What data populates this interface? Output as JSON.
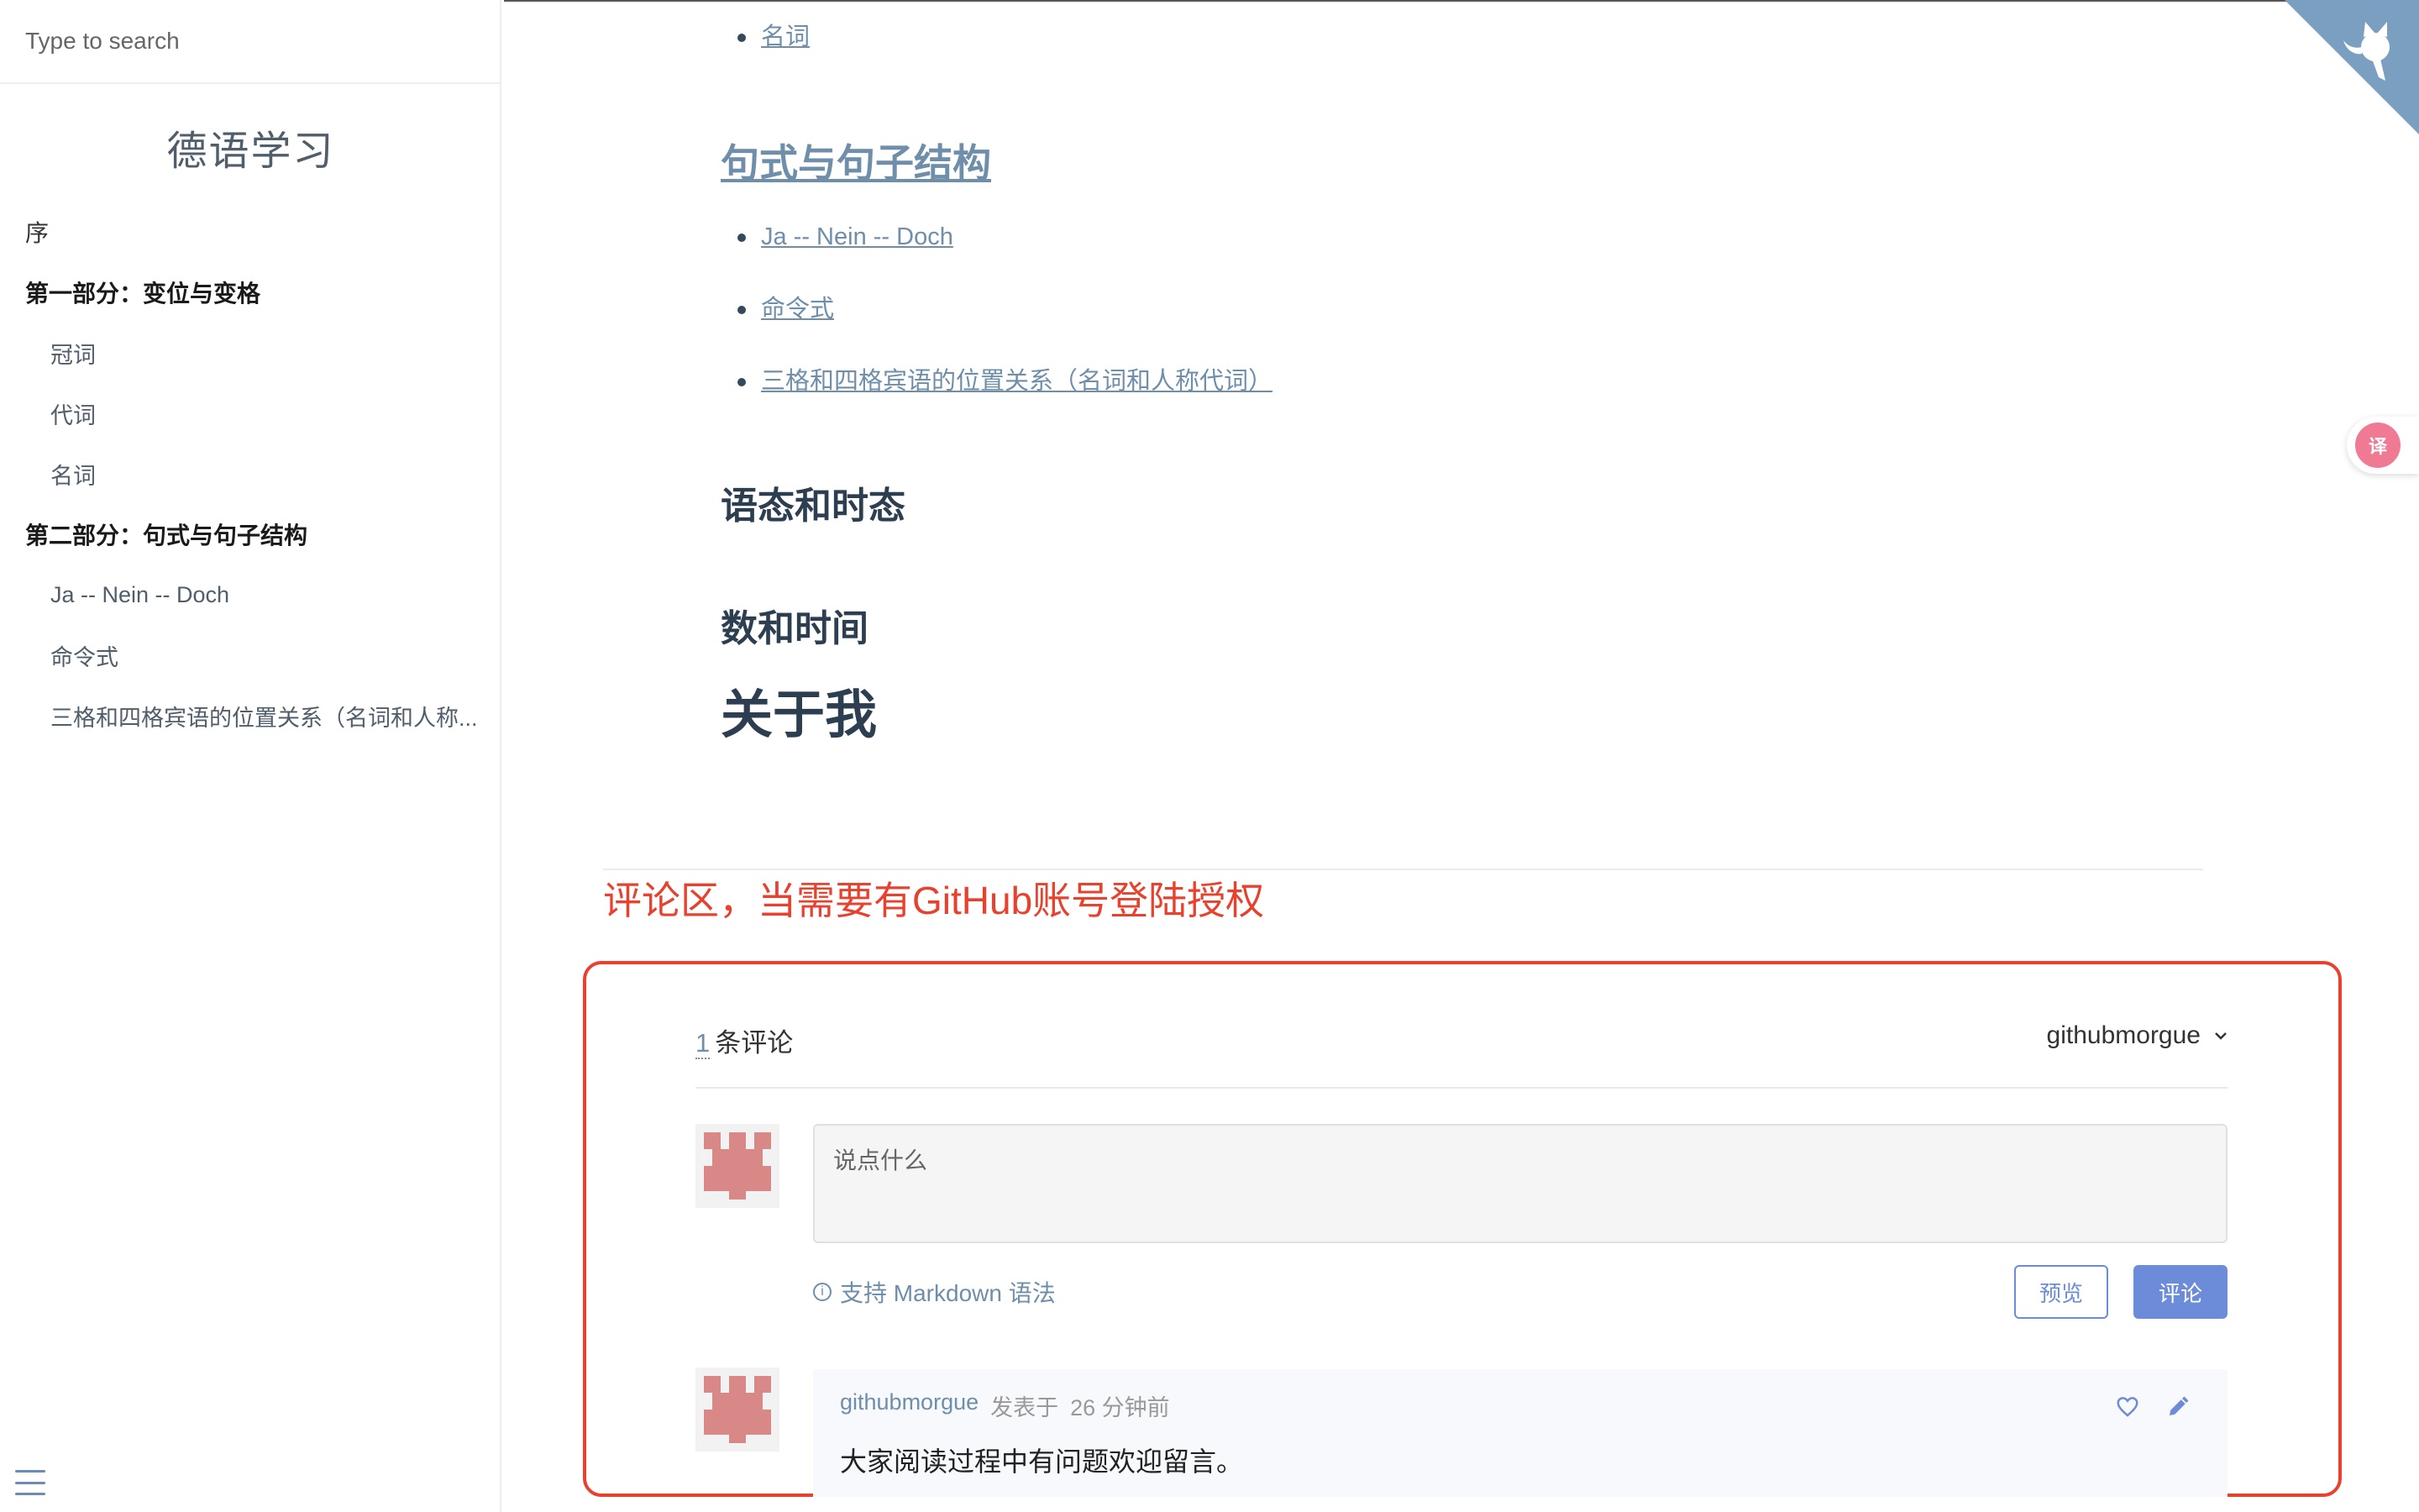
{
  "search": {
    "placeholder": "Type to search"
  },
  "sidebar": {
    "app_name": "德语学习",
    "items": [
      {
        "label": "序"
      },
      {
        "label": "第一部分：变位与变格"
      },
      {
        "label": "冠词"
      },
      {
        "label": "代词"
      },
      {
        "label": "名词"
      },
      {
        "label": "第二部分：句式与句子结构"
      },
      {
        "label": "Ja -- Nein -- Doch"
      },
      {
        "label": "命令式"
      },
      {
        "label": "三格和四格宾语的位置关系（名词和人称..."
      }
    ]
  },
  "content": {
    "top_item": "名词",
    "section_heading": "句式与句子结构",
    "section_items": [
      "Ja -- Nein -- Doch",
      "命令式",
      "三格和四格宾语的位置关系（名词和人称代词）"
    ],
    "heading_voice": "语态和时态",
    "heading_numbers": "数和时间",
    "heading_about": "关于我",
    "annotation": "评论区，当需要有GitHub账号登陆授权"
  },
  "comments": {
    "count": "1",
    "count_label": "条评论",
    "user": "githubmorgue",
    "placeholder": "说点什么",
    "markdown_tip": "支持 Markdown 语法",
    "preview_label": "预览",
    "submit_label": "评论",
    "items": [
      {
        "author": "githubmorgue",
        "posted_label": "发表于",
        "time": "26 分钟前",
        "body": "大家阅读过程中有问题欢迎留言。"
      }
    ]
  },
  "colors": {
    "link": "#6e8eaa",
    "annotation_red": "#e8412e",
    "button_blue": "#6c8bd9",
    "corner_bg": "#7a9fc0",
    "translate_pink": "#f07a93"
  },
  "icons": [
    "github-cat-icon",
    "translate-icon",
    "menu-icon",
    "chevron-down-icon",
    "info-icon",
    "heart-icon",
    "edit-icon"
  ]
}
